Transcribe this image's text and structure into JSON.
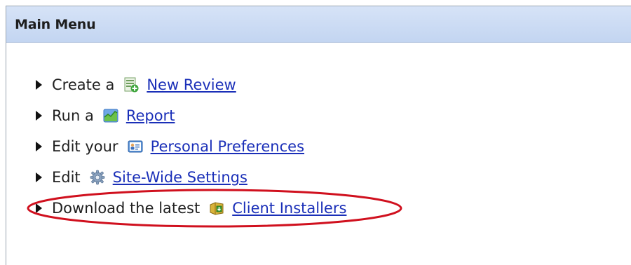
{
  "header": {
    "title": "Main Menu"
  },
  "menu": {
    "items": [
      {
        "prefix": "Create a",
        "link": "New Review",
        "icon": "new-review-icon"
      },
      {
        "prefix": "Run a",
        "link": "Report",
        "icon": "report-chart-icon"
      },
      {
        "prefix": "Edit your",
        "link": "Personal Preferences",
        "icon": "personal-card-icon"
      },
      {
        "prefix": "Edit",
        "link": "Site-Wide Settings",
        "icon": "gear-icon"
      },
      {
        "prefix": "Download the latest",
        "link": "Client Installers",
        "icon": "installer-package-icon"
      }
    ]
  },
  "annotation": {
    "color": "#d0101e",
    "shape": "ellipse around Client Installers item"
  },
  "colors": {
    "header_bg": "#c8d9f3",
    "link": "#1a2fb8"
  }
}
